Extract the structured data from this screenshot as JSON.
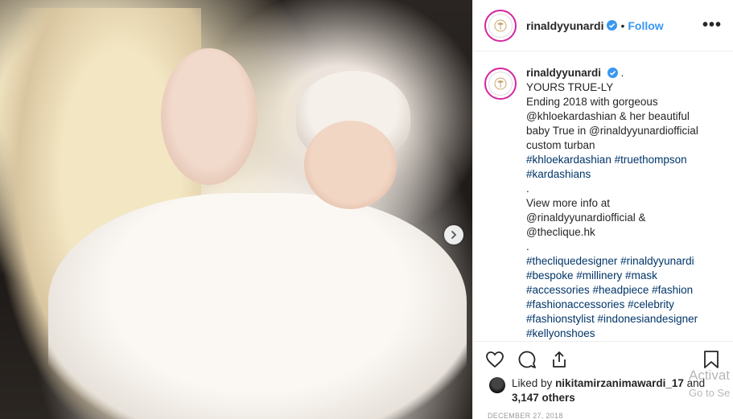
{
  "post": {
    "username": "rinaldyyunardi",
    "follow_label": "Follow",
    "dot": "•",
    "more_label": "•••"
  },
  "caption": {
    "username": "rinaldyyunardi",
    "lines": [
      {
        "text": "YOURS TRUE-LY",
        "hash": false
      },
      {
        "text": "Ending 2018 with gorgeous",
        "hash": false
      },
      {
        "text": "@khloekardashian & her beautiful",
        "hash": false
      },
      {
        "text": "baby True in @rinaldyyunardiofficial",
        "hash": false
      },
      {
        "text": "custom turban",
        "hash": false
      },
      {
        "text": "#khloekardashian #truethompson",
        "hash": true
      },
      {
        "text": "#kardashians",
        "hash": true
      },
      {
        "text": ".",
        "hash": false
      },
      {
        "text": "View more info at",
        "hash": false
      },
      {
        "text": "@rinaldyyunardiofficial &",
        "hash": false
      },
      {
        "text": "@theclique.hk",
        "hash": false
      },
      {
        "text": ".",
        "hash": false
      },
      {
        "text": "#thecliquedesigner #rinaldyyunardi",
        "hash": true
      },
      {
        "text": "#bespoke #millinery #mask",
        "hash": true
      },
      {
        "text": "#accessories #headpiece #fashion",
        "hash": true
      },
      {
        "text": "#fashionaccessories #celebrity",
        "hash": true
      },
      {
        "text": "#fashionstylist #indonesiandesigner",
        "hash": true
      },
      {
        "text": "#kellyonshoes",
        "hash": true
      }
    ],
    "period": "."
  },
  "likes": {
    "prefix": "Liked by",
    "user": "nikitamirzanimawardi_17",
    "and": "and",
    "others": "3,147 others"
  },
  "date": "DECEMBER 27, 2018",
  "watermark": {
    "line1": "Activat",
    "line2": "Go to Se"
  },
  "icons": {
    "next": "chevron-right-icon",
    "verified": "verified-badge-icon",
    "like": "heart-icon",
    "comment": "comment-icon",
    "share": "share-icon",
    "save": "bookmark-icon"
  },
  "colors": {
    "link": "#3897f0",
    "hashtag": "#003569",
    "avatar_ring": "#d6249f"
  }
}
